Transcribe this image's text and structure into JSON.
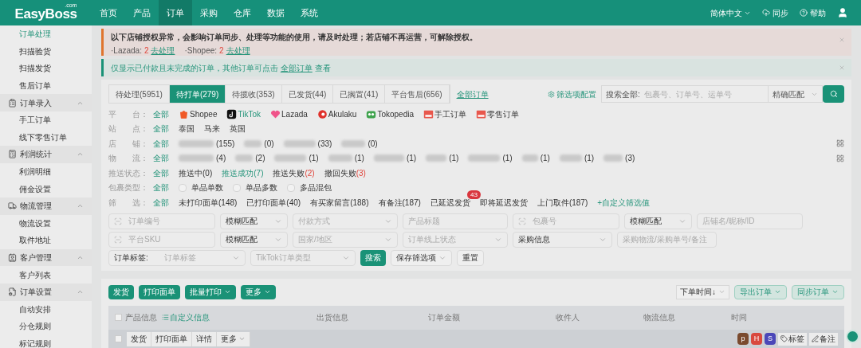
{
  "header": {
    "logo": "EasyBoss",
    "logo_sup": ".com",
    "nav": [
      {
        "label": "首页",
        "selected": false
      },
      {
        "label": "产品",
        "selected": false
      },
      {
        "label": "订单",
        "selected": true
      },
      {
        "label": "采购",
        "selected": false
      },
      {
        "label": "仓库",
        "selected": false
      },
      {
        "label": "数据",
        "selected": false
      },
      {
        "label": "系统",
        "selected": false
      }
    ],
    "language": "简体中文",
    "sync": "同步",
    "help": "帮助"
  },
  "sidebar": {
    "items": [
      {
        "kind": "item",
        "label": "订单处理",
        "selected": true
      },
      {
        "kind": "item",
        "label": "扫描验货",
        "selected": false
      },
      {
        "kind": "item",
        "label": "扫描发货",
        "selected": false
      },
      {
        "kind": "item",
        "label": "售后订单",
        "selected": false
      },
      {
        "kind": "group",
        "label": "订单录入",
        "expanded": true,
        "children": [
          {
            "label": "手工订单",
            "selected": false
          },
          {
            "label": "线下零售订单",
            "selected": false
          }
        ]
      },
      {
        "kind": "group",
        "label": "利润统计",
        "expanded": true,
        "children": [
          {
            "label": "利润明细",
            "selected": false
          },
          {
            "label": "佣金设置",
            "selected": false
          }
        ]
      },
      {
        "kind": "group",
        "label": "物流管理",
        "expanded": true,
        "children": [
          {
            "label": "物流设置",
            "selected": false
          },
          {
            "label": "取件地址",
            "selected": false
          }
        ]
      },
      {
        "kind": "group",
        "label": "客户管理",
        "expanded": true,
        "children": [
          {
            "label": "客户列表",
            "selected": false
          }
        ]
      },
      {
        "kind": "group",
        "label": "订单设置",
        "expanded": true,
        "children": [
          {
            "label": "自动安排",
            "selected": false
          },
          {
            "label": "分仓规则",
            "selected": false
          },
          {
            "label": "标记规则",
            "selected": false
          }
        ]
      }
    ]
  },
  "alerts": [
    {
      "kind": "warning",
      "text": "以下店铺授权异常，会影响订单同步、处理等功能的使用，请及时处理；若店铺不再运营，可解除授权。",
      "entries": [
        {
          "platform": "·Lazada:",
          "count": "2",
          "action": "去处理"
        },
        {
          "platform": "·Shopee:",
          "count": "2",
          "action": "去处理"
        }
      ]
    },
    {
      "kind": "info",
      "text": "仅显示已付款且未完成的订单，其他订单可点击",
      "link": "全部订单",
      "after": "查看"
    }
  ],
  "tabs": [
    {
      "label": "待处理(5951)",
      "selected": false
    },
    {
      "label": "待打单(279)",
      "selected": true
    },
    {
      "label": "待揽收(353)",
      "selected": false
    },
    {
      "label": "已发货(44)",
      "selected": false
    },
    {
      "label": "已搁置(41)",
      "selected": false
    },
    {
      "label": "平台售后(656)",
      "selected": false
    }
  ],
  "all_orders_link": "全部订单",
  "filter_config": "筛选项配置",
  "search": {
    "label": "搜索全部:",
    "placeholder": "包裹号、订单号、运单号",
    "match": "精确匹配"
  },
  "filters": [
    {
      "label": "平　　台：",
      "grid": false,
      "options": [
        {
          "kind": "text",
          "label": "全部",
          "selected": true
        },
        {
          "kind": "platform",
          "color": "#f05a28",
          "label": "Shopee",
          "highlighted": false
        },
        {
          "kind": "platform",
          "color": "#111111",
          "label": "TikTok",
          "highlighted": true
        },
        {
          "kind": "platform",
          "color": "#f0548a",
          "label": "Lazada",
          "highlighted": false
        },
        {
          "kind": "platform",
          "color": "#e0312b",
          "label": "Akulaku",
          "highlighted": false
        },
        {
          "kind": "platform",
          "color": "#3fa34d",
          "label": "Tokopedia",
          "highlighted": false
        },
        {
          "kind": "platform",
          "color": "#e8574c",
          "label": "手工订单",
          "highlighted": false
        },
        {
          "kind": "platform",
          "color": "#e8574c",
          "label": "零售订单",
          "highlighted": false
        }
      ]
    },
    {
      "label": "站　　点：",
      "grid": false,
      "options": [
        {
          "kind": "text",
          "label": "全部",
          "selected": true
        },
        {
          "kind": "text",
          "label": "泰国",
          "selected": false
        },
        {
          "kind": "text",
          "label": "马来",
          "selected": false
        },
        {
          "kind": "text",
          "label": "英国",
          "selected": false
        }
      ]
    },
    {
      "label": "店　　铺：",
      "grid": true,
      "options": [
        {
          "kind": "text",
          "label": "全部",
          "selected": true
        },
        {
          "kind": "masked",
          "count": "(155)"
        },
        {
          "kind": "masked",
          "count": "(0)"
        },
        {
          "kind": "masked",
          "count": "(33)"
        },
        {
          "kind": "masked",
          "count": "(0)"
        }
      ]
    },
    {
      "label": "物　　流：",
      "grid": true,
      "options": [
        {
          "kind": "text",
          "label": "全部",
          "selected": true
        },
        {
          "kind": "masked",
          "count": "(4)"
        },
        {
          "kind": "masked",
          "count": "(2)"
        },
        {
          "kind": "masked",
          "count": "(1)"
        },
        {
          "kind": "masked",
          "count": "(1)"
        },
        {
          "kind": "masked",
          "count": "(1)"
        },
        {
          "kind": "masked",
          "count": "(1)"
        },
        {
          "kind": "masked",
          "count": "(1)"
        },
        {
          "kind": "masked",
          "count": "(1)"
        },
        {
          "kind": "masked",
          "count": "(1)"
        },
        {
          "kind": "masked",
          "count": "(3)"
        }
      ]
    },
    {
      "label": "推送状态：",
      "grid": false,
      "options": [
        {
          "kind": "text",
          "label": "全部",
          "selected": true
        },
        {
          "kind": "text",
          "label": "推送中(0)",
          "selected": false
        },
        {
          "kind": "text",
          "label": "推送成功(7)",
          "selected": true
        },
        {
          "kind": "failed",
          "label": "推送失败",
          "count": "(2)",
          "selected": false
        },
        {
          "kind": "failed",
          "label": "撤回失败",
          "count": "(3)",
          "selected": false
        }
      ]
    },
    {
      "label": "包裹类型：",
      "grid": false,
      "options": [
        {
          "kind": "text",
          "label": "全部",
          "selected": true
        },
        {
          "kind": "checkbox",
          "label": "单品单数",
          "checked": false
        },
        {
          "kind": "checkbox",
          "label": "单品多数",
          "checked": false
        },
        {
          "kind": "checkbox",
          "label": "多品混包",
          "checked": false
        }
      ]
    },
    {
      "label": "筛　　选：",
      "grid": false,
      "options": [
        {
          "kind": "text",
          "label": "全部",
          "selected": true
        },
        {
          "kind": "text",
          "label": "未打印面单(148)",
          "selected": false
        },
        {
          "kind": "text",
          "label": "已打印面单(40)",
          "selected": false
        },
        {
          "kind": "text",
          "label": "有买家留言(188)",
          "selected": false
        },
        {
          "kind": "text",
          "label": "有备注(187)",
          "selected": false
        },
        {
          "kind": "text",
          "label": "已延迟发货",
          "badge": "43",
          "selected": false
        },
        {
          "kind": "text",
          "label": "即将延迟发货",
          "selected": false
        },
        {
          "kind": "text",
          "label": "上门取件(187)",
          "selected": false
        },
        {
          "kind": "link",
          "label": "+自定义筛选值"
        }
      ]
    }
  ],
  "form_rows": [
    [
      {
        "kind": "scan",
        "placeholder": "订单编号"
      },
      {
        "kind": "select",
        "value": "模糊匹配"
      },
      {
        "kind": "select",
        "placeholder": "付款方式"
      },
      {
        "kind": "input",
        "placeholder": "产品标题"
      },
      {
        "kind": "scan",
        "placeholder": "包裹号"
      },
      {
        "kind": "select",
        "value": "模糊匹配"
      },
      {
        "kind": "input",
        "placeholder": "店铺名/昵称/ID"
      }
    ],
    [
      {
        "kind": "scan",
        "placeholder": "平台SKU"
      },
      {
        "kind": "select",
        "value": "模糊匹配"
      },
      {
        "kind": "select",
        "placeholder": "国家/地区"
      },
      {
        "kind": "select",
        "placeholder": "订单线上状态"
      },
      {
        "kind": "select",
        "value": "采购信息"
      },
      {
        "kind": "input",
        "placeholder": "采购物流/采购单号/备注"
      }
    ],
    [
      {
        "kind": "labeled",
        "label": "订单标签:",
        "placeholder": "订单标签"
      },
      {
        "kind": "select",
        "placeholder": "TikTok订单类型"
      },
      {
        "kind": "primary",
        "label": "搜索"
      },
      {
        "kind": "dropdown",
        "label": "保存筛选项"
      },
      {
        "kind": "plain",
        "label": "重置"
      }
    ]
  ],
  "actions": [
    {
      "label": "发货",
      "caret": false
    },
    {
      "label": "打印面单",
      "caret": false
    },
    {
      "label": "批量打印",
      "caret": true
    },
    {
      "label": "更多",
      "caret": true
    }
  ],
  "sort": "下单时间↓",
  "right_actions": [
    {
      "label": "导出订单"
    },
    {
      "label": "同步订单"
    }
  ],
  "table": {
    "checked": false,
    "columns": [
      "产品信息",
      "出货信息",
      "订单金额",
      "收件人",
      "物流信息",
      "时间"
    ],
    "custom_info": "自定义信息",
    "row": {
      "checked": false,
      "buttons": [
        {
          "label": "发货",
          "caret": false
        },
        {
          "label": "打印面单",
          "caret": false
        },
        {
          "label": "详情",
          "caret": false
        },
        {
          "label": "更多",
          "caret": true
        }
      ],
      "badges": [
        {
          "label": "p",
          "color": "#7a4a2e"
        },
        {
          "label": "H",
          "color": "#d9493f"
        },
        {
          "label": "S",
          "color": "#4b47b8"
        }
      ],
      "tag": "标签",
      "note": "备注"
    }
  }
}
